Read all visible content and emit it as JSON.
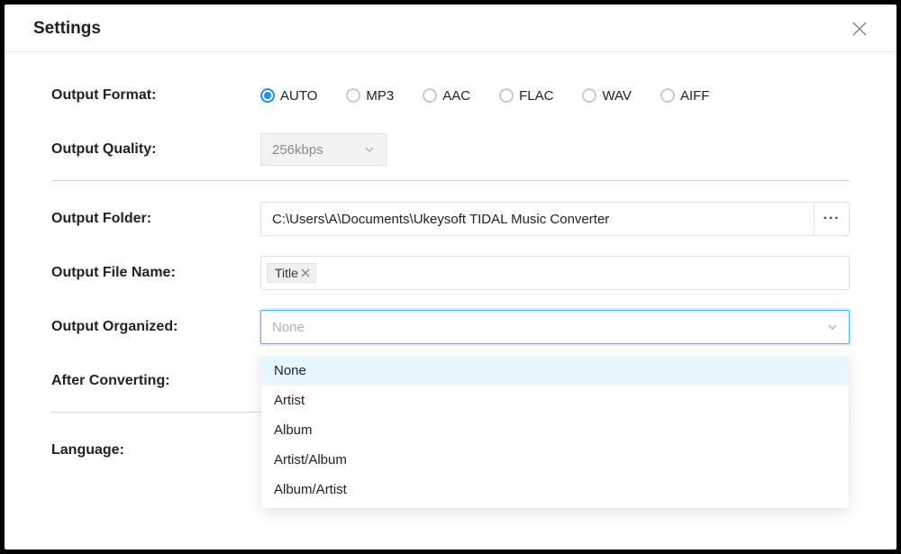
{
  "modal": {
    "title": "Settings"
  },
  "labels": {
    "outputFormat": "Output Format:",
    "outputQuality": "Output Quality:",
    "outputFolder": "Output Folder:",
    "outputFileName": "Output File Name:",
    "outputOrganized": "Output Organized:",
    "afterConverting": "After Converting:",
    "language": "Language:"
  },
  "outputFormat": {
    "selected": "AUTO",
    "options": [
      "AUTO",
      "MP3",
      "AAC",
      "FLAC",
      "WAV",
      "AIFF"
    ]
  },
  "outputQuality": {
    "value": "256kbps",
    "disabled": true
  },
  "outputFolder": {
    "value": "C:\\Users\\A\\Documents\\Ukeysoft TIDAL Music Converter",
    "browseLabel": "···"
  },
  "outputFileName": {
    "tags": [
      "Title"
    ]
  },
  "outputOrganized": {
    "placeholder": "None",
    "options": [
      "None",
      "Artist",
      "Album",
      "Artist/Album",
      "Album/Artist"
    ],
    "highlighted": "None"
  }
}
